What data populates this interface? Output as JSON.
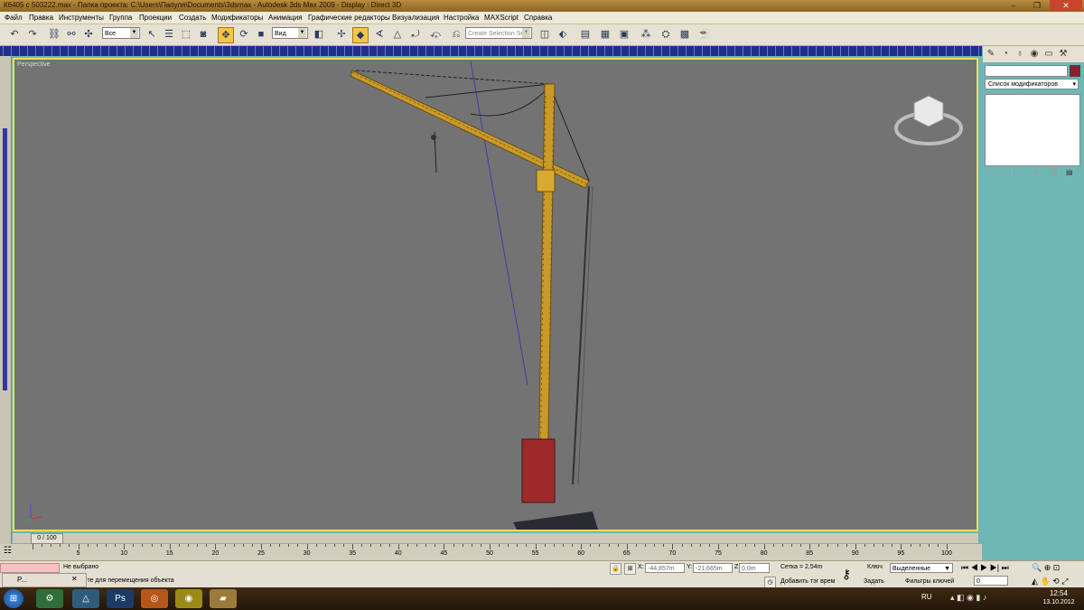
{
  "titlebar": {
    "text": "К6405 с 503222.max      -  Папка проекта: C:\\Users\\Папуля\\Documents\\3dsmax      -  Autodesk 3ds Max  2009       -  Display : Direct 3D",
    "minimize": "–",
    "restore": "❐",
    "close": "✕"
  },
  "menu": [
    "Файл",
    "Правка",
    "Инструменты",
    "Группа",
    "Проекции",
    "Создать",
    "Модификаторы",
    "Анимация",
    "Графические редакторы",
    "Визуализация",
    "Настройка",
    "MAXScript",
    "Справка"
  ],
  "toolbar": {
    "selection_filter": "Все",
    "ref_coord": "Вид",
    "named_selection_placeholder": "Create Selection Set"
  },
  "viewport": {
    "label": "Perspective"
  },
  "command_panel": {
    "modifier_list": "Список модификаторов"
  },
  "timeline": {
    "frame_indicator": "0 / 100",
    "ticks": [
      "5",
      "10",
      "15",
      "20",
      "25",
      "30",
      "35",
      "40",
      "45",
      "50",
      "55",
      "60",
      "65",
      "70",
      "75",
      "80",
      "85",
      "90",
      "95",
      "100"
    ]
  },
  "status": {
    "selection": "Не выбрано",
    "prompt": "н перенесите для перемещения объекта",
    "x_label": "X:",
    "x_value": "-44,857m",
    "y_label": "Y:",
    "y_value": "-21,665m",
    "z_label": "Z:",
    "z_value": "0,0m",
    "grid": "Сетка = 2,54m",
    "add_tag": "Добавить тэг врем",
    "key_label": "Ключ",
    "set_label": "Задать",
    "selected_dropdown": "Выделенные",
    "key_filters": "Фильтры ключей",
    "frame_value": "0"
  },
  "taskbar": {
    "mini_window": "P...",
    "lang": "RU",
    "time": "12:54",
    "date": "13.10.2012"
  },
  "colors": {
    "accent": "#f3c64a",
    "viewport_border": "#e7e34a",
    "crane": "#c99a2a"
  }
}
